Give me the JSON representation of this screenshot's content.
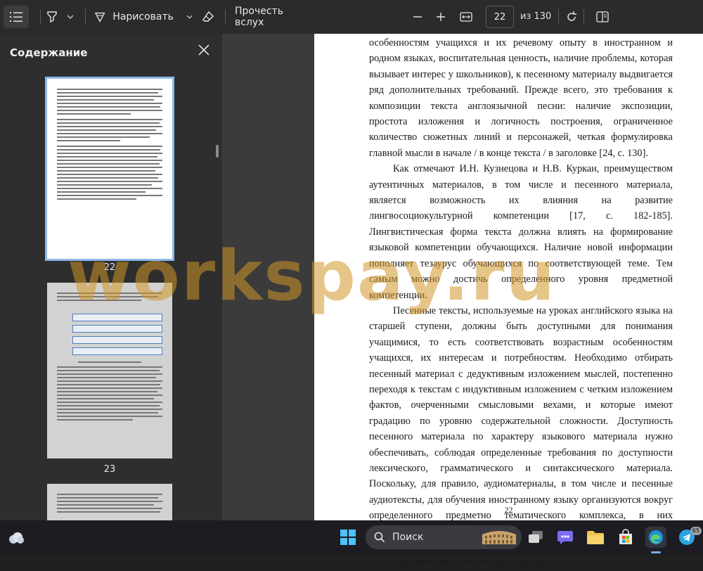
{
  "toolbar": {
    "draw_label": "Нарисовать",
    "read_aloud_label": "Прочесть вслух",
    "page_current": "22",
    "page_total": "из 130"
  },
  "sidebar": {
    "title": "Содержание",
    "thumbnails": [
      {
        "label": "22"
      },
      {
        "label": "23"
      }
    ]
  },
  "document": {
    "paragraphs": [
      {
        "indent": false,
        "text": "особенностям учащихся и их речевому опыту в иностранном и родном языках, воспитательная ценность, наличие проблемы, которая вызывает интерес у школьников), к песенному материалу выдвигается ряд дополнительных требований. Прежде всего, это требования к композиции текста англоязычной песни: наличие экспозиции, простота изложения и логичность построения, ограниченное количество сюжетных линий и персонажей, четкая формулировка главной мысли в начале / в конце текста / в заголовке [24, с. 130]."
      },
      {
        "indent": true,
        "text": "Как отмечают И.Н. Кузнецова и Н.В. Куркан, преимуществом аутентичных материалов, в том числе и песенного материала, является возможность их влияния на развитие лингвосоциокультурной компетенции [17, с. 182-185]. Лингвистическая форма текста должна влиять на формирование языковой компетенции обучающихся. Наличие новой информации пополняет тезаурус обучающихся по соответствующей теме. Тем самым можно достичь определенного уровня предметной компетенции."
      },
      {
        "indent": true,
        "text": "Песенные тексты, используемые на уроках английского языка на старшей ступени, должны быть доступными для понимания учащимися, то есть соответствовать возрастным особенностям учащихся, их интересам и потребностям. Необходимо отбирать песенный материал с дедуктивным изложением мыслей, постепенно переходя к текстам с индуктивным изложением с четким изложением фактов, очерченными смысловыми вехами, и которые имеют градацию по уровню содержательной сложности. Доступность песенного материала по характеру языкового материала нужно обеспечивать, соблюдая определенные требования по доступности лексического, грамматического и синтаксического материала. Поскольку, для правило, аудиоматериалы, в том числе и песенные аудиотексты, для обучения иностранному языку организуются вокруг определенного предметно тематического комплекса, в них наблюдается использование ограниченного набора лексических единиц. Тематика аудиотекстов помогает идентифицировать значение полисемантических лексических единиц."
      }
    ],
    "page_number": "22",
    "watermark": "workspay.ru"
  },
  "taskbar": {
    "search_label": "Поиск",
    "telegram_badge": "65"
  },
  "colors": {
    "accent": "#7aa8e6",
    "toolbar_bg": "#2b2b2b",
    "sidebar_bg": "#2e2e2e",
    "watermark": "#d29628"
  }
}
